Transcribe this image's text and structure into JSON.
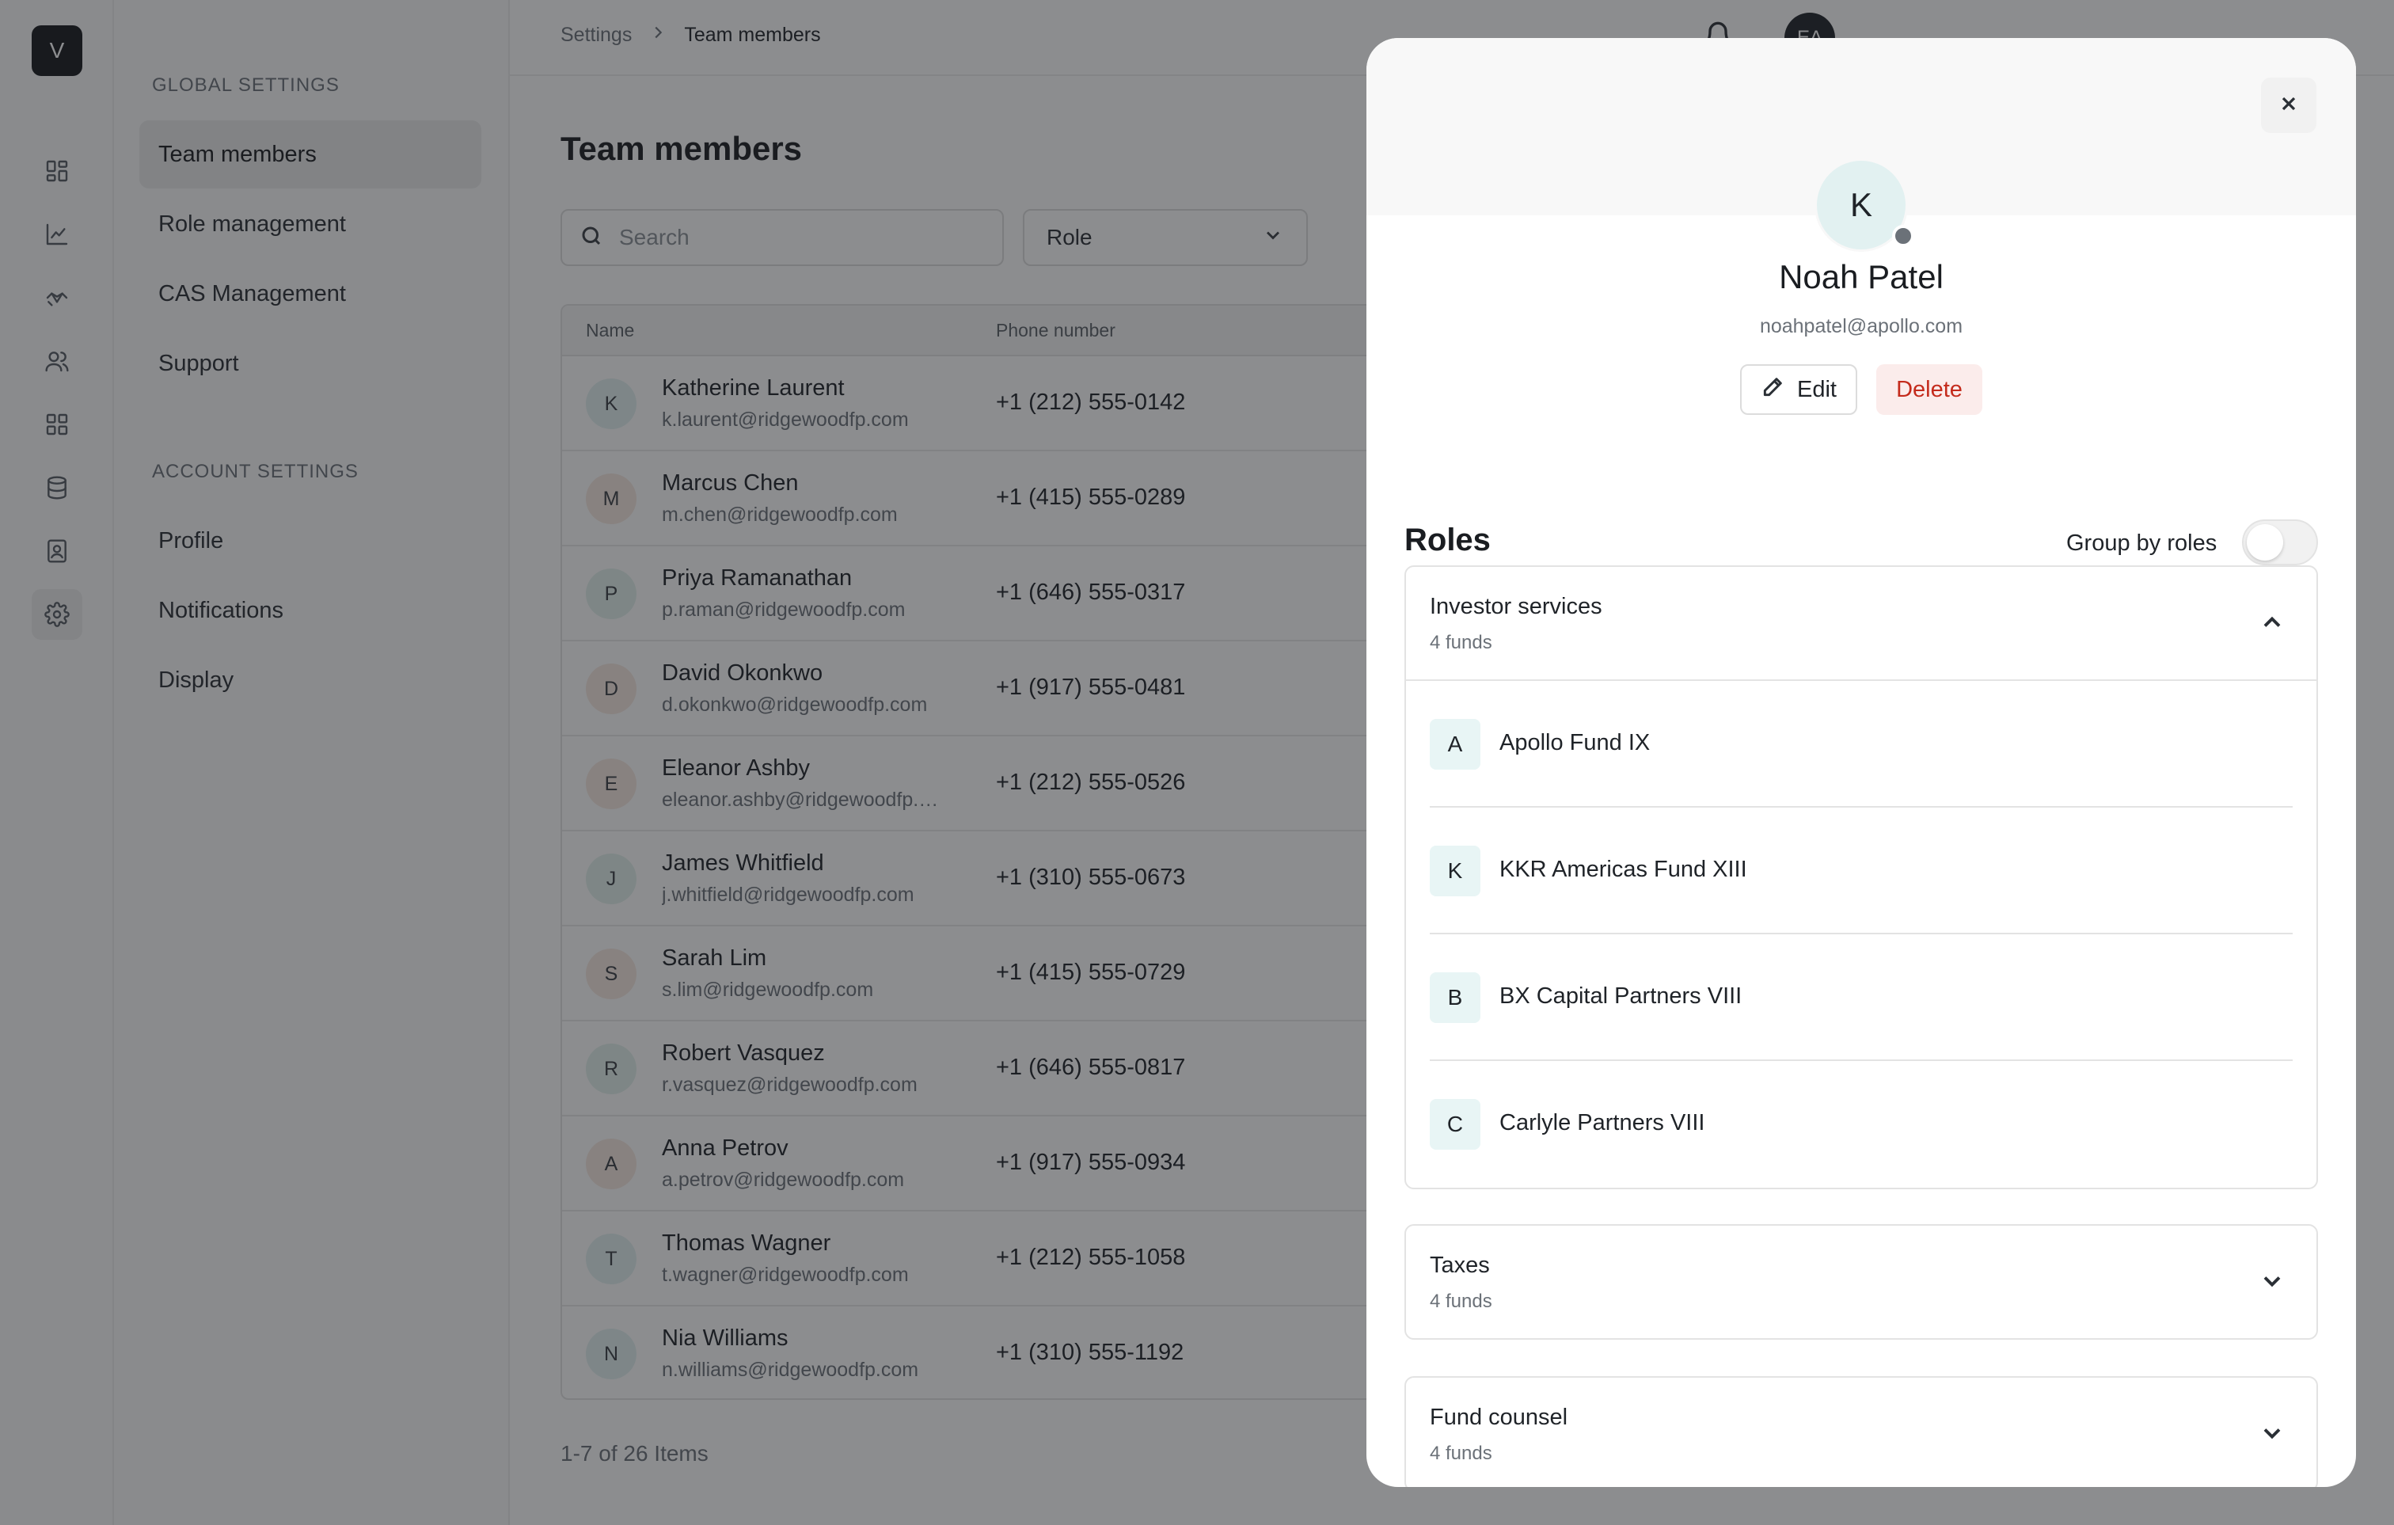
{
  "app": {
    "logo_letter": "V"
  },
  "rail": {
    "icons": [
      "dashboard-icon",
      "chart-icon",
      "handshake-icon",
      "users-icon",
      "grid-icon",
      "database-icon",
      "contacts-book-icon",
      "gear-icon"
    ],
    "active": "gear-icon"
  },
  "settings_nav": {
    "global_heading": "GLOBAL SETTINGS",
    "global_items": [
      "Team members",
      "Role management",
      "CAS Management",
      "Support"
    ],
    "account_heading": "ACCOUNT SETTINGS",
    "account_items": [
      "Profile",
      "Notifications",
      "Display"
    ],
    "active": "Team members"
  },
  "topbar": {
    "breadcrumb": [
      "Settings",
      "Team members"
    ],
    "user_initials": "EA"
  },
  "main": {
    "title": "Team members",
    "search_placeholder": "Search",
    "role_filter": "Role",
    "columns": [
      "Name",
      "Phone number"
    ],
    "rows": [
      {
        "initial": "K",
        "name": "Katherine Laurent",
        "email": "k.laurent@ridgewoodfp.com",
        "phone": "+1 (212) 555-0142",
        "avatar_color": "#e2f1f1"
      },
      {
        "initial": "M",
        "name": "Marcus Chen",
        "email": "m.chen@ridgewoodfp.com",
        "phone": "+1 (415) 555-0289",
        "avatar_color": "#f6e9e1"
      },
      {
        "initial": "P",
        "name": "Priya Ramanathan",
        "email": "p.raman@ridgewoodfp.com",
        "phone": "+1 (646) 555-0317",
        "avatar_color": "#e2f1ec"
      },
      {
        "initial": "D",
        "name": "David Okonkwo",
        "email": "d.okonkwo@ridgewoodfp.com",
        "phone": "+1 (917) 555-0481",
        "avatar_color": "#f6e9e1"
      },
      {
        "initial": "E",
        "name": "Eleanor Ashby",
        "email": "eleanor.ashby@ridgewoodfp.com",
        "phone": "+1 (212) 555-0526",
        "avatar_color": "#f6e9e1"
      },
      {
        "initial": "J",
        "name": "James Whitfield",
        "email": "j.whitfield@ridgewoodfp.com",
        "phone": "+1 (310) 555-0673",
        "avatar_color": "#e2f1ec"
      },
      {
        "initial": "S",
        "name": "Sarah Lim",
        "email": "s.lim@ridgewoodfp.com",
        "phone": "+1 (415) 555-0729",
        "avatar_color": "#f6e9e1"
      },
      {
        "initial": "R",
        "name": "Robert Vasquez",
        "email": "r.vasquez@ridgewoodfp.com",
        "phone": "+1 (646) 555-0817",
        "avatar_color": "#e2f1ec"
      },
      {
        "initial": "A",
        "name": "Anna Petrov",
        "email": "a.petrov@ridgewoodfp.com",
        "phone": "+1 (917) 555-0934",
        "avatar_color": "#f6e9e1"
      },
      {
        "initial": "T",
        "name": "Thomas Wagner",
        "email": "t.wagner@ridgewoodfp.com",
        "phone": "+1 (212) 555-1058",
        "avatar_color": "#e2f1f1"
      },
      {
        "initial": "N",
        "name": "Nia Williams",
        "email": "n.williams@ridgewoodfp.com",
        "phone": "+1 (310) 555-1192",
        "avatar_color": "#e2f1f1"
      }
    ],
    "pagination": "1-7 of 26 Items"
  },
  "drawer": {
    "avatar_initial": "K",
    "name": "Noah Patel",
    "email": "noahpatel@apollo.com",
    "edit_label": "Edit",
    "delete_label": "Delete",
    "roles_title": "Roles",
    "group_by_label": "Group by roles",
    "group_by_on": false,
    "role_groups": [
      {
        "title": "Investor services",
        "subtitle": "4 funds",
        "expanded": true,
        "funds": [
          {
            "letter": "A",
            "name": "Apollo Fund IX"
          },
          {
            "letter": "K",
            "name": "KKR Americas Fund XIII"
          },
          {
            "letter": "B",
            "name": "BX Capital Partners VIII"
          },
          {
            "letter": "C",
            "name": "Carlyle Partners VIII"
          }
        ]
      },
      {
        "title": "Taxes",
        "subtitle": "4 funds",
        "expanded": false,
        "funds": []
      },
      {
        "title": "Fund counsel",
        "subtitle": "4 funds",
        "expanded": false,
        "funds": []
      }
    ]
  },
  "colors": {
    "overlay": "#191c20",
    "delete_text": "#c42b1c",
    "delete_bg": "#fbeceb",
    "fund_badge_bg": "#e8f5f5"
  }
}
